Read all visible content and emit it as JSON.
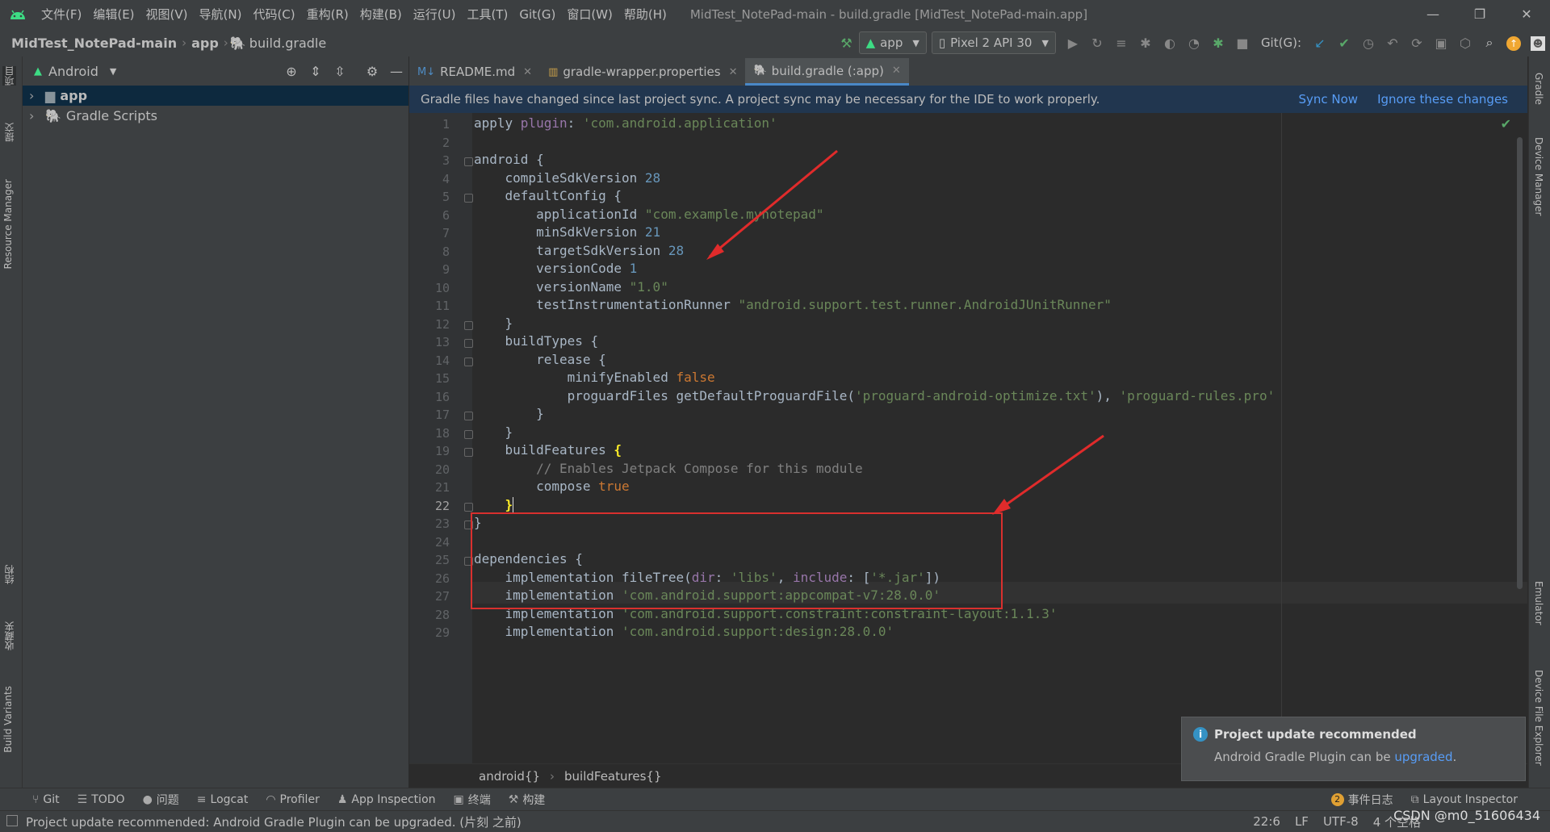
{
  "menu": [
    "文件(F)",
    "编辑(E)",
    "视图(V)",
    "导航(N)",
    "代码(C)",
    "重构(R)",
    "构建(B)",
    "运行(U)",
    "工具(T)",
    "Git(G)",
    "窗口(W)",
    "帮助(H)"
  ],
  "window_title": "MidTest_NotePad-main - build.gradle [MidTest_NotePad-main.app]",
  "breadcrumb": {
    "project": "MidTest_NotePad-main",
    "module": "app",
    "file": "build.gradle"
  },
  "toolbar": {
    "run_config": "app",
    "device": "Pixel 2 API 30",
    "git_label": "Git(G):"
  },
  "left_strip": [
    "项目",
    "提交",
    "Resource Manager",
    "结构",
    "收藏夹",
    "Build Variants"
  ],
  "right_strip": [
    "Gradle",
    "Device Manager",
    "Emulator",
    "Device File Explorer"
  ],
  "project_panel": {
    "view": "Android",
    "tree": [
      "app",
      "Gradle Scripts"
    ]
  },
  "tabs": [
    "README.md",
    "gradle-wrapper.properties",
    "build.gradle (:app)"
  ],
  "notification": {
    "message": "Gradle files have changed since last project sync. A project sync may be necessary for the IDE to work properly.",
    "sync": "Sync Now",
    "ignore": "Ignore these changes"
  },
  "code_lines": [
    "apply plugin: 'com.android.application'",
    "",
    "android {",
    "    compileSdkVersion 28",
    "    defaultConfig {",
    "        applicationId \"com.example.mynotepad\"",
    "        minSdkVersion 21",
    "        targetSdkVersion 28",
    "        versionCode 1",
    "        versionName \"1.0\"",
    "        testInstrumentationRunner \"android.support.test.runner.AndroidJUnitRunner\"",
    "    }",
    "    buildTypes {",
    "        release {",
    "            minifyEnabled false",
    "            proguardFiles getDefaultProguardFile('proguard-android-optimize.txt'), 'proguard-rules.pro'",
    "        }",
    "    }",
    "    buildFeatures {",
    "        // Enables Jetpack Compose for this module",
    "        compose true",
    "    }",
    "}",
    "",
    "dependencies {",
    "    implementation fileTree(dir: 'libs', include: ['*.jar'])",
    "    implementation 'com.android.support:appcompat-v7:28.0.0'",
    "    implementation 'com.android.support.constraint:constraint-layout:1.1.3'",
    "    implementation 'com.android.support:design:28.0.0'"
  ],
  "current_line": 22,
  "editor_breadcrumb": [
    "android{}",
    "buildFeatures{}"
  ],
  "bottom_tools": [
    "Git",
    "TODO",
    "问题",
    "Logcat",
    "Profiler",
    "App Inspection",
    "终端",
    "构建"
  ],
  "bottom_right": {
    "event_log_count": "2",
    "event_log": "事件日志",
    "layout_inspector": "Layout Inspector"
  },
  "status": {
    "message": "Project update recommended: Android Gradle Plugin can be upgraded. (片刻 之前)",
    "position": "22:6",
    "line_sep": "LF",
    "encoding": "UTF-8",
    "indent": "4 个空格"
  },
  "popup": {
    "title": "Project update recommended",
    "body": "Android Gradle Plugin can be ",
    "link": "upgraded",
    "tail": "."
  },
  "watermark": "CSDN @m0_51606434",
  "colors": {
    "keyword": "#cc7832",
    "string": "#6a8759",
    "number": "#6897bb",
    "comment": "#808080",
    "plugin": "#9876aa",
    "link": "#589df6",
    "annotation": "#d9302e"
  }
}
